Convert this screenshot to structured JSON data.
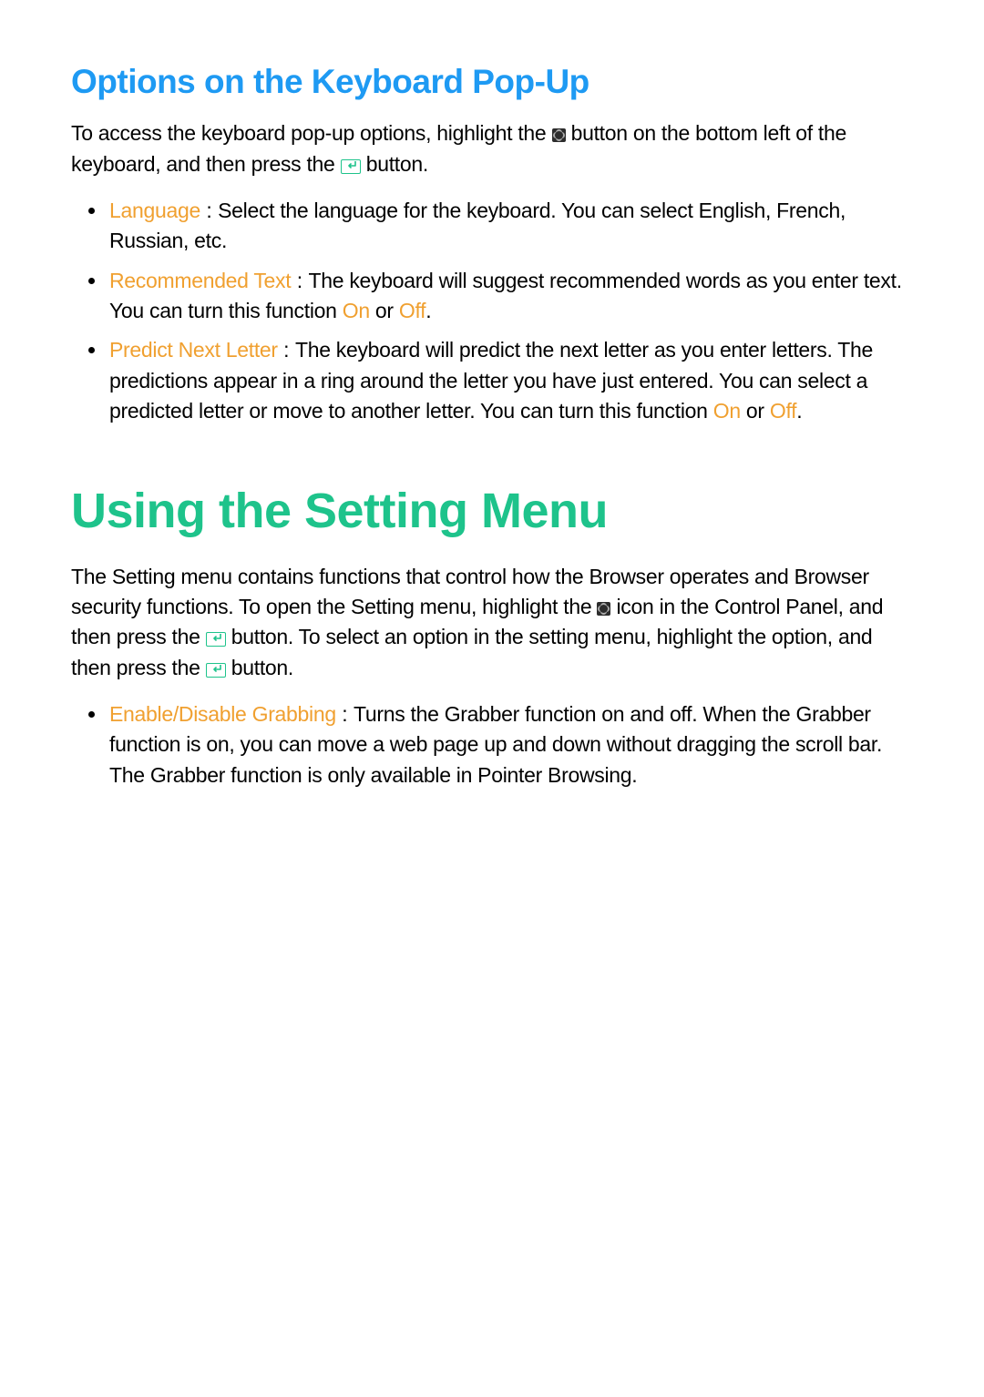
{
  "section1": {
    "title": "Options on the Keyboard Pop-Up",
    "intro_a": "To access the keyboard pop-up options, highlight the ",
    "intro_b": " button on the bottom left of the keyboard, and then press the ",
    "intro_c": " button.",
    "items": [
      {
        "term": "Language",
        "sep": " : ",
        "body": "Select the language for the keyboard. You can select English, French, Russian, etc."
      },
      {
        "term": "Recommended Text",
        "sep": " : ",
        "body_a": "The keyboard will suggest recommended words as you enter text. You can turn this function ",
        "on": "On",
        "or": " or ",
        "off": "Off",
        "body_b": "."
      },
      {
        "term": "Predict Next Letter",
        "sep": " : ",
        "body_a": "The keyboard will predict the next letter as you enter letters. The predictions appear in a ring around the letter you have just entered. You can select a predicted letter or move to another letter. You can turn this function ",
        "on": "On",
        "or": " or ",
        "off": "Off",
        "body_b": "."
      }
    ]
  },
  "section2": {
    "title": "Using the Setting Menu",
    "intro_a": "The Setting menu contains functions that control how the Browser operates and Browser security functions. To open the Setting menu, highlight the ",
    "intro_b": " icon in the Control Panel, and then press the ",
    "intro_c": " button. To select an option in the setting menu, highlight the option, and then press the ",
    "intro_d": " button.",
    "items": [
      {
        "term": "Enable/Disable Grabbing",
        "sep": " : ",
        "body": "Turns the Grabber function on and off. When the Grabber function is on, you can move a web page up and down without dragging the scroll bar. The Grabber function is only available in Pointer Browsing."
      }
    ]
  }
}
